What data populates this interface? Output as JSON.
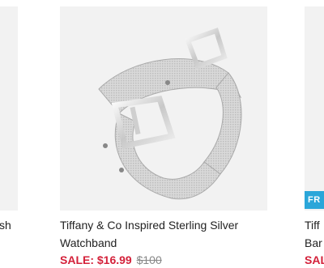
{
  "left_card": {
    "title_fragment": "sh"
  },
  "center_card": {
    "title_line1": "Tiffany & Co Inspired Sterling Silver",
    "title_line2": "Watchband",
    "sale_price": "SALE: $16.99",
    "original_price": "$100",
    "image_icon": "mesh-watchband-image"
  },
  "right_card": {
    "badge": "FR",
    "title_line1": "Tiff",
    "title_line2": "Bar",
    "sale_fragment": "SAL"
  },
  "colors": {
    "sale_red": "#d4213a",
    "badge_blue": "#2ba6d9",
    "image_bg": "#f2f2f2"
  }
}
